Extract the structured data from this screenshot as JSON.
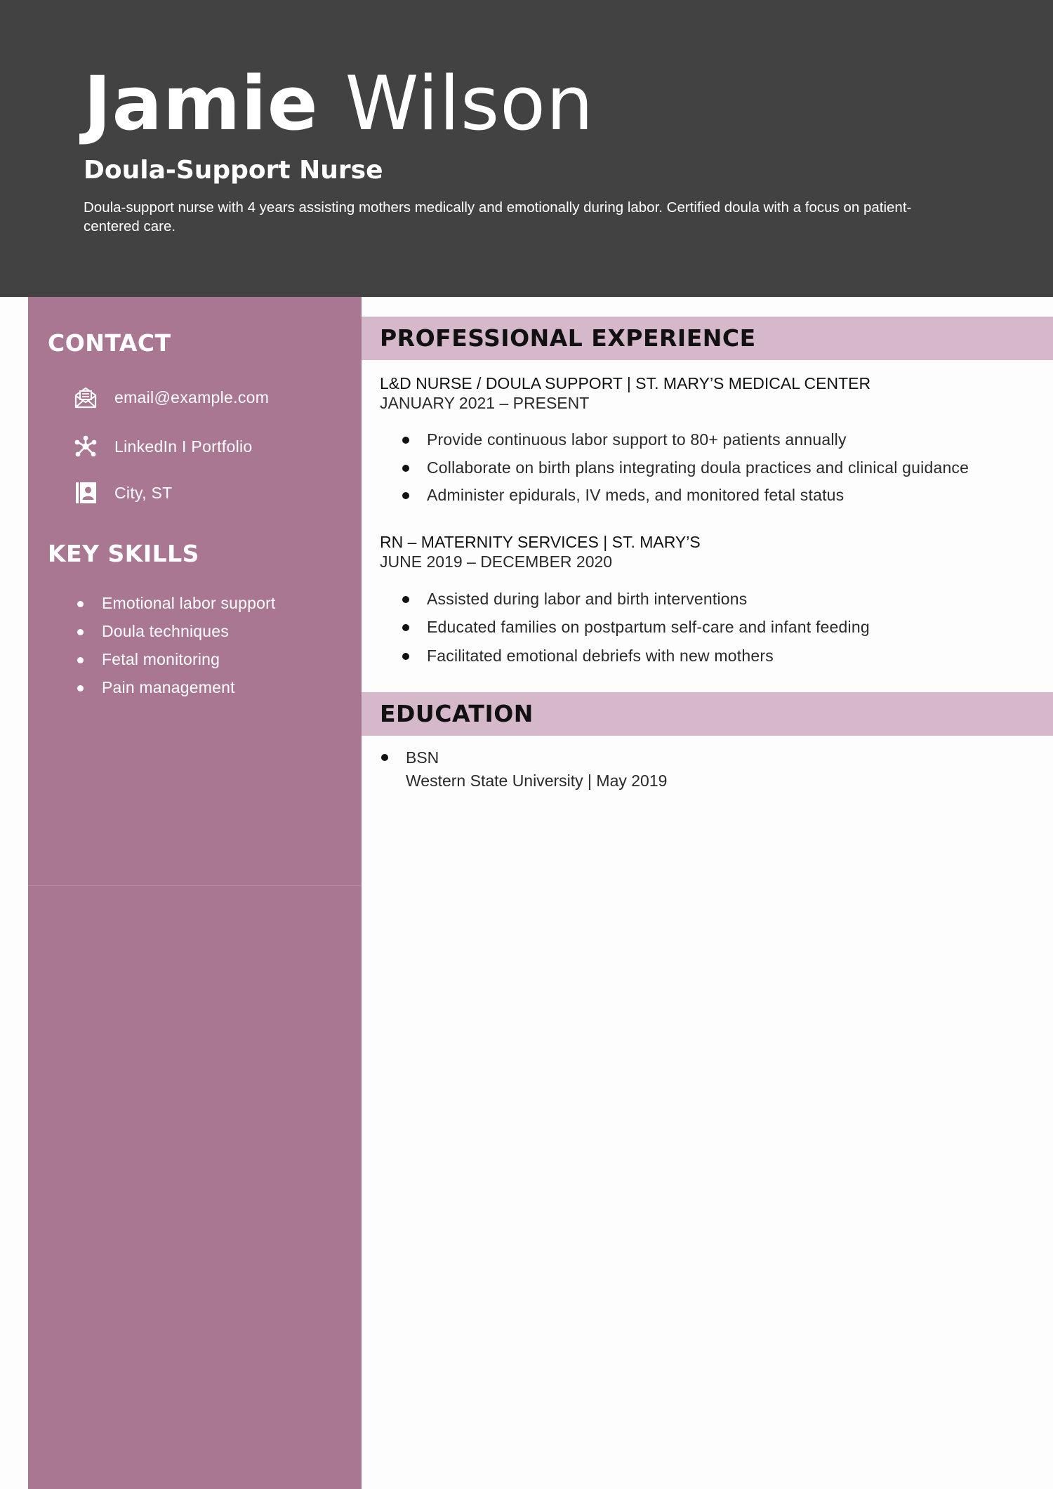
{
  "header": {
    "first_name": "Jamie",
    "last_name": "Wilson",
    "job_title": "Doula-Support Nurse",
    "summary": "Doula-support nurse with 4 years assisting mothers medically and emotionally during labor. Certified doula with a focus on patient-centered care."
  },
  "sidebar": {
    "contact_heading": "CONTACT",
    "contact": [
      {
        "icon": "envelope-icon",
        "label": "email@example.com"
      },
      {
        "icon": "network-icon",
        "label": "LinkedIn I Portfolio"
      },
      {
        "icon": "address-book-icon",
        "label": "City, ST"
      }
    ],
    "skills_heading": "KEY SKILLS",
    "skills": [
      "Emotional labor support",
      "Doula techniques",
      "Fetal monitoring",
      "Pain management"
    ]
  },
  "main": {
    "experience_heading": "PROFESSIONAL EXPERIENCE",
    "jobs": [
      {
        "title": "L&D NURSE / DOULA SUPPORT | ST. MARY’S MEDICAL CENTER",
        "dates": "JANUARY 2021 – PRESENT",
        "bullets": [
          "Provide continuous labor support to 80+ patients annually",
          "Collaborate on birth plans integrating doula practices and clinical guidance",
          "Administer epidurals, IV meds, and monitored fetal status"
        ]
      },
      {
        "title": "RN – MATERNITY SERVICES | ST. MARY’S",
        "dates": "JUNE 2019 – DECEMBER 2020",
        "bullets": [
          "Assisted during labor and birth interventions",
          "Educated families on postpartum self-care and infant feeding",
          "Facilitated emotional debriefs with new mothers"
        ]
      }
    ],
    "education_heading": "EDUCATION",
    "education": {
      "degree": "BSN",
      "school": "Western State University | May 2019"
    }
  },
  "colors": {
    "header_bg": "#424242",
    "sidebar_bg": "#aa7793",
    "section_band": "#d5b8c9",
    "page_bg": "#fdfdfd"
  }
}
